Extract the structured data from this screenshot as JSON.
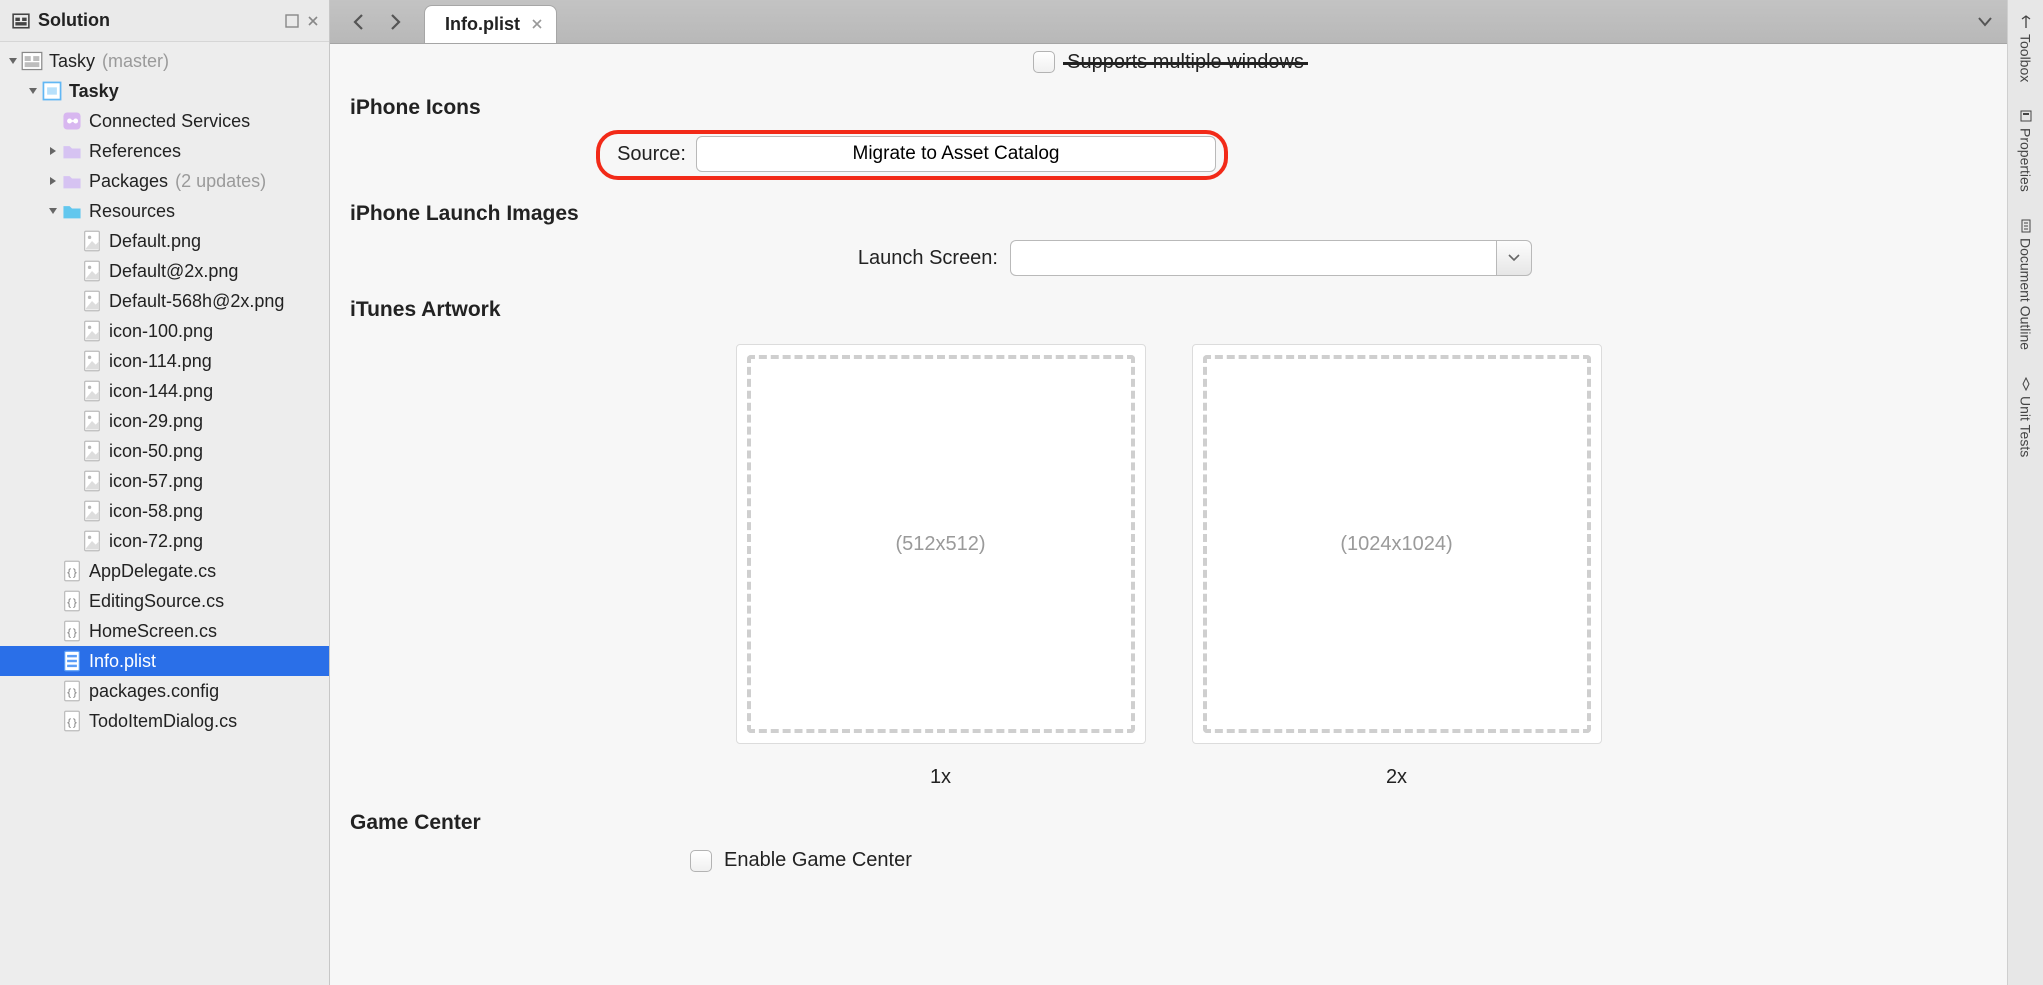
{
  "solution": {
    "pad_title": "Solution",
    "root": {
      "label": "Tasky",
      "branch": "(master)"
    },
    "project": {
      "label": "Tasky"
    },
    "connected_services": "Connected Services",
    "references": "References",
    "packages": {
      "label": "Packages",
      "hint": "(2 updates)"
    },
    "resources": "Resources",
    "files": [
      "Default.png",
      "Default@2x.png",
      "Default-568h@2x.png",
      "icon-100.png",
      "icon-114.png",
      "icon-144.png",
      "icon-29.png",
      "icon-50.png",
      "icon-57.png",
      "icon-58.png",
      "icon-72.png"
    ],
    "cs_files": [
      "AppDelegate.cs",
      "EditingSource.cs",
      "HomeScreen.cs"
    ],
    "info_plist": "Info.plist",
    "more_files": [
      "packages.config",
      "TodoItemDialog.cs"
    ]
  },
  "tab": {
    "label": "Info.plist"
  },
  "cutoff": {
    "line1": "Supports multiple windows"
  },
  "sections": {
    "iphone_icons": "iPhone Icons",
    "iphone_launch": "iPhone Launch Images",
    "itunes_artwork": "iTunes Artwork",
    "game_center": "Game Center"
  },
  "iphone_icons": {
    "source_label": "Source:",
    "migrate": "Migrate to Asset Catalog"
  },
  "launch": {
    "label": "Launch Screen:",
    "value": ""
  },
  "artwork": {
    "well1": "(512x512)",
    "well2": "(1024x1024)",
    "lbl1": "1x",
    "lbl2": "2x"
  },
  "gamecenter": {
    "enable": "Enable Game Center"
  },
  "right_tabs": {
    "toolbox": "Toolbox",
    "properties": "Properties",
    "outline": "Document Outline",
    "unit": "Unit Tests"
  },
  "colors": {
    "highlight": "#f22a18",
    "selection": "#2a6fe8"
  }
}
